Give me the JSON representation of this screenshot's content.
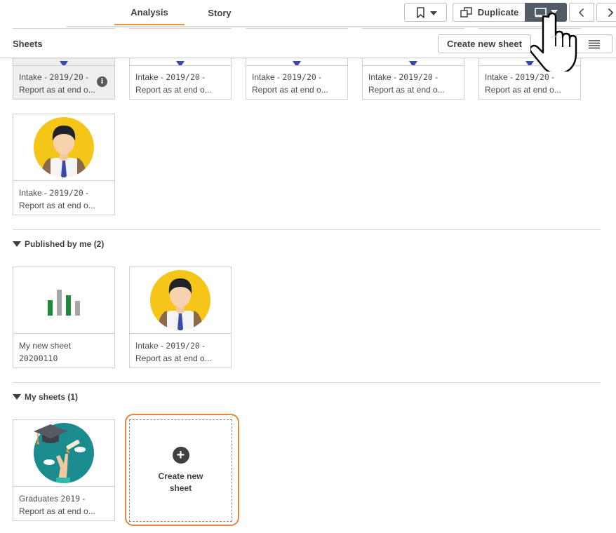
{
  "toolbar": {
    "tabs": [
      {
        "label": "Analysis",
        "active": true
      },
      {
        "label": "Story",
        "active": false
      }
    ],
    "duplicate_label": "Duplicate",
    "accent_color": "#e9943c"
  },
  "sheets_panel": {
    "title": "Sheets",
    "create_button_label": "Create new sheet",
    "sections": {
      "base": {
        "cards": [
          {
            "line1": "Intake - ",
            "line1_code": "2019/20",
            "line1_end": " -",
            "line2": "Report as at end o..."
          },
          {
            "line1": "Intake - ",
            "line1_code": "2019/20",
            "line1_end": " -",
            "line2": "Report as at end o..."
          },
          {
            "line1": "Intake - ",
            "line1_code": "2019/20",
            "line1_end": " -",
            "line2": "Report as at end o..."
          },
          {
            "line1": "Intake - ",
            "line1_code": "2019/20",
            "line1_end": " -",
            "line2": "Report as at end o..."
          },
          {
            "line1": "Intake - ",
            "line1_code": "2019/20",
            "line1_end": " -",
            "line2": "Report as at end o..."
          },
          {
            "line1": "Intake - ",
            "line1_code": "2019/20",
            "line1_end": " -",
            "line2": "Report as at end o..."
          }
        ]
      },
      "published": {
        "title": "Published by me (2)",
        "cards": [
          {
            "line1": "My new sheet",
            "line2": "20200110"
          },
          {
            "line1": "Intake - ",
            "line1_code": "2019/20",
            "line1_end": " -",
            "line2": "Report as at end o..."
          }
        ]
      },
      "mine": {
        "title": "My sheets (1)",
        "cards": [
          {
            "line1": "Graduates ",
            "line1_code": "2019",
            "line1_end": " -",
            "line2": "Report as at end o..."
          }
        ],
        "create_card_label": "Create new sheet",
        "create_card_highlight": "#e9843c"
      }
    }
  },
  "icons": {
    "bookmark": "bookmark-icon",
    "duplicate": "duplicate-icon",
    "sheet": "sheet-icon",
    "prev": "chevron-left-icon",
    "next": "chevron-right-icon",
    "list": "list-icon",
    "plus": "plus-icon",
    "info": "info-icon",
    "cursor": "hand-cursor-icon"
  }
}
